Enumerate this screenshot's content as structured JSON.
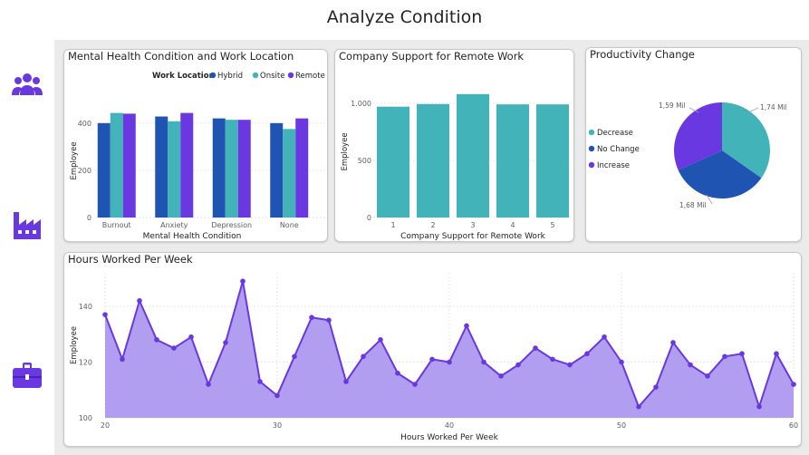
{
  "page": {
    "title": "Analyze Condition"
  },
  "nav": {
    "items": [
      {
        "name": "employees-icon"
      },
      {
        "name": "factory-icon"
      },
      {
        "name": "briefcase-icon"
      }
    ]
  },
  "colors": {
    "hybrid": "#1f54b3",
    "onsite": "#41b3b9",
    "remote": "#6a38e0",
    "area_fill": "#b19ef0",
    "area_line": "#6a38e0",
    "teal": "#41b3b9"
  },
  "chart_data": [
    {
      "id": "mental-health-location",
      "type": "bar",
      "title": "Mental Health Condition and Work Location",
      "xlabel": "Mental Health Condition",
      "ylabel": "Employee",
      "legend_title": "Work Location",
      "legend_position": "top-right",
      "categories": [
        "Burnout",
        "Anxiety",
        "Depression",
        "None"
      ],
      "series": [
        {
          "name": "Hybrid",
          "values": [
            400,
            428,
            420,
            400
          ]
        },
        {
          "name": "Onsite",
          "values": [
            443,
            408,
            414,
            375
          ]
        },
        {
          "name": "Remote",
          "values": [
            440,
            443,
            414,
            420
          ]
        }
      ],
      "y_ticks": [
        "0",
        "200",
        "400"
      ],
      "ylim": [
        0,
        480
      ],
      "grid": true
    },
    {
      "id": "company-support",
      "type": "bar",
      "title": "Company Support for Remote Work",
      "xlabel": "Company Support for Remote Work",
      "ylabel": "Employee",
      "categories": [
        "1",
        "2",
        "3",
        "4",
        "5"
      ],
      "values": [
        970,
        993,
        1080,
        990,
        990
      ],
      "y_ticks": [
        "0",
        "500",
        "1.000"
      ],
      "ylim": [
        0,
        1150
      ],
      "grid": true
    },
    {
      "id": "productivity-change",
      "type": "pie",
      "title": "Productivity Change",
      "legend_position": "left",
      "slices": [
        {
          "name": "Decrease",
          "value": 1.74,
          "label": "1,74 Mil"
        },
        {
          "name": "No Change",
          "value": 1.68,
          "label": "1,68 Mil"
        },
        {
          "name": "Increase",
          "value": 1.59,
          "label": "1,59 Mil"
        }
      ]
    },
    {
      "id": "hours-worked",
      "type": "area",
      "title": "Hours Worked Per Week",
      "xlabel": "Hours Worked Per Week",
      "ylabel": "Employee",
      "x": [
        20,
        21,
        22,
        23,
        24,
        25,
        26,
        27,
        28,
        29,
        30,
        31,
        32,
        33,
        34,
        35,
        36,
        37,
        38,
        39,
        40,
        41,
        42,
        43,
        44,
        45,
        46,
        47,
        48,
        49,
        50,
        51,
        52,
        53,
        54,
        55,
        56,
        57,
        58,
        59,
        60
      ],
      "y": [
        137,
        121,
        142,
        128,
        125,
        129,
        112,
        127,
        149,
        113,
        108,
        122,
        136,
        135,
        113,
        122,
        128,
        116,
        112,
        121,
        120,
        133,
        120,
        115,
        119,
        125,
        121,
        119,
        123,
        129,
        120,
        104,
        111,
        127,
        119,
        115,
        122,
        123,
        104,
        123,
        112
      ],
      "x_ticks": [
        "20",
        "30",
        "40",
        "50",
        "60"
      ],
      "y_ticks": [
        "100",
        "120",
        "140"
      ],
      "xlim": [
        20,
        60
      ],
      "ylim": [
        100,
        152
      ],
      "grid": true
    }
  ]
}
